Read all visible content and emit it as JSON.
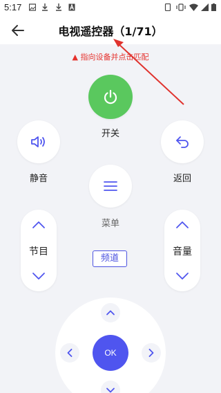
{
  "status_bar": {
    "time": "5:17"
  },
  "header": {
    "title": "电视遥控器（1/71）"
  },
  "hint": {
    "text": "指向设备并点击匹配"
  },
  "buttons": {
    "power_label": "开关",
    "mute_label": "静音",
    "back_label": "返回",
    "menu_label": "菜单",
    "channel_label": "节目",
    "volume_label": "音量",
    "channel_tag": "频道",
    "ok_label": "OK"
  },
  "colors": {
    "power": "#5ac85e",
    "accent": "#4f55ef",
    "hint_red": "#e5312d"
  }
}
